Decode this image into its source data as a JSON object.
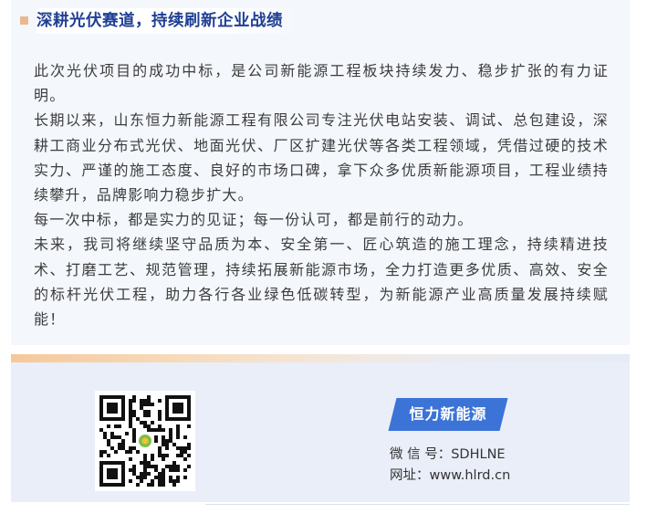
{
  "section": {
    "title": "深耕光伏赛道，持续刷新企业战绩"
  },
  "article": {
    "paragraphs": [
      "此次光伏项目的成功中标，是公司新能源工程板块持续发力、稳步扩张的有力证明。",
      "长期以来，山东恒力新能源工程有限公司专注光伏电站安装、调试、总包建设，深耕工商业分布式光伏、地面光伏、厂区扩建光伏等各类工程领域，凭借过硬的技术实力、严谨的施工态度、良好的市场口碑，拿下众多优质新能源项目，工程业绩持续攀升，品牌影响力稳步扩大。",
      "每一次中标，都是实力的见证；每一份认可，都是前行的动力。",
      "未来，我司将继续坚守品质为本、安全第一、匠心筑造的施工理念，持续精进技术、打磨工艺、规范管理，持续拓展新能源市场，全力打造更多优质、高效、安全的标杆光伏工程，助力各行各业绿色低碳转型，为新能源产业高质量发展持续赋能！"
    ]
  },
  "footer": {
    "brand_tag": "恒力新能源",
    "wechat_line": "微 信 号：SDHLNE",
    "website_line": "网址：www.hlrd.cn",
    "qr_icon": "qr-code-icon"
  },
  "colors": {
    "title": "#1f3f93",
    "tag": "#3b74d6",
    "accent": "#e9b88f"
  }
}
